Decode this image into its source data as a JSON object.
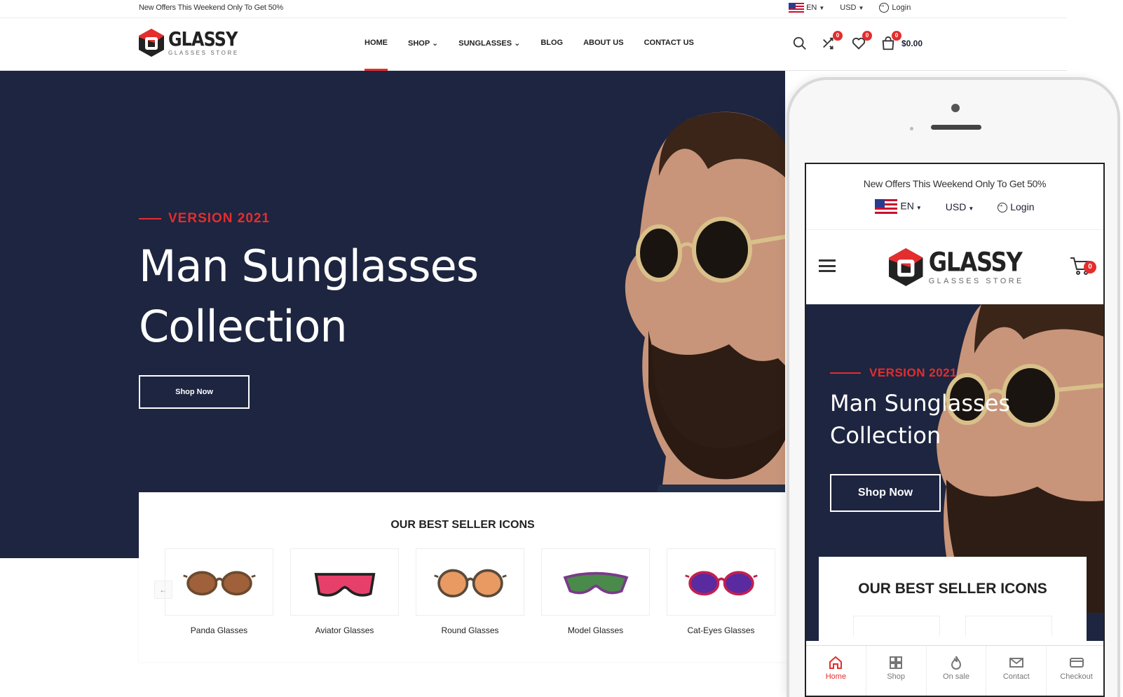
{
  "topbar": {
    "offer": "New Offers This Weekend Only To Get 50%",
    "language": "EN",
    "currency": "USD",
    "login": "Login"
  },
  "brand": {
    "name": "GLASSY",
    "tagline": "GLASSES STORE"
  },
  "nav": {
    "items": [
      {
        "label": "HOME"
      },
      {
        "label": "SHOP ⌄"
      },
      {
        "label": "SUNGLASSES ⌄"
      },
      {
        "label": "BLOG"
      },
      {
        "label": "ABOUT US"
      },
      {
        "label": "CONTACT US"
      }
    ],
    "active_index": 0
  },
  "header_icons": {
    "compare_count": "0",
    "wishlist_count": "0",
    "cart_count": "0",
    "cart_total": "$0.00"
  },
  "hero": {
    "eyebrow": "VERSION 2021",
    "title_line1": "Man Sunglasses",
    "title_line2": "Collection",
    "button": "Shop Now"
  },
  "best_sellers": {
    "title": "OUR BEST SELLER ICONS",
    "prev": "←",
    "products": [
      {
        "name": "Panda Glasses",
        "lens_color": "#a0603a",
        "frame_color": "#6b4a2f"
      },
      {
        "name": "Aviator Glasses",
        "lens_color": "#e6406a",
        "frame_color": "#222222"
      },
      {
        "name": "Round Glasses",
        "lens_color": "#e99a62",
        "frame_color": "#5a4a3a"
      },
      {
        "name": "Model Glasses",
        "lens_color": "#4a8a4a",
        "frame_color": "#7a3a8a"
      },
      {
        "name": "Cat-Eyes Glasses",
        "lens_color": "#5a2aa0",
        "frame_color": "#c02050"
      }
    ]
  },
  "mobile": {
    "offer": "New Offers This Weekend Only To Get 50%",
    "language": "EN",
    "currency": "USD",
    "login": "Login",
    "cart_count": "0",
    "eyebrow": "VERSION 2021",
    "title_line1": "Man Sunglasses",
    "title_line2": "Collection",
    "button": "Shop Now",
    "best_title": "OUR BEST SELLER ICONS",
    "tabs": [
      {
        "label": "Home",
        "icon": "home-icon"
      },
      {
        "label": "Shop",
        "icon": "grid-icon"
      },
      {
        "label": "On sale",
        "icon": "flame-icon"
      },
      {
        "label": "Contact",
        "icon": "mail-icon"
      },
      {
        "label": "Checkout",
        "icon": "card-icon"
      }
    ]
  },
  "colors": {
    "accent": "#e52d2d",
    "hero_bg": "#1d2540",
    "text": "#1c2033"
  }
}
